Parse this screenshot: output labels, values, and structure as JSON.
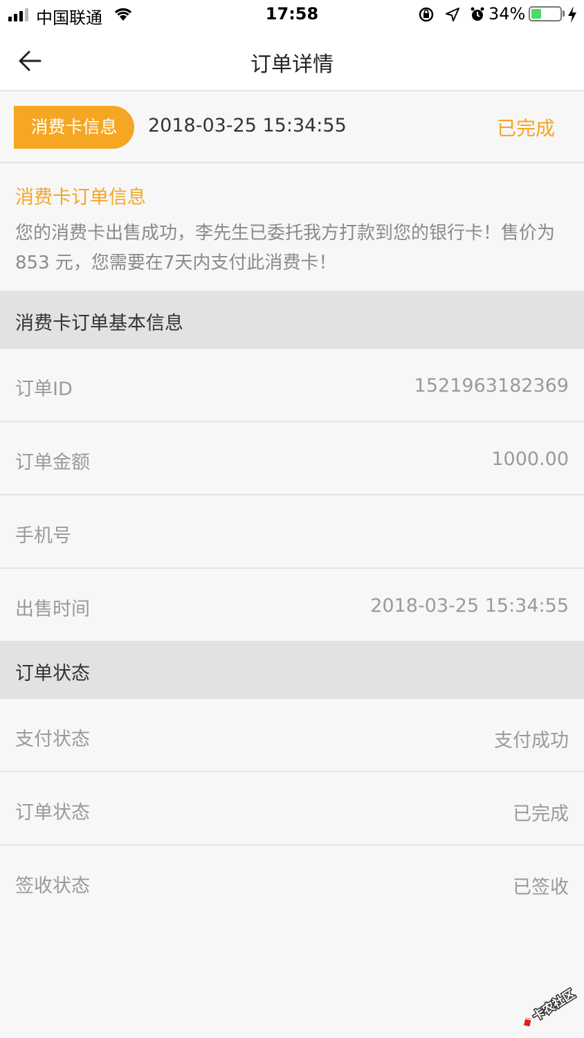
{
  "status_bar": {
    "carrier": "中国联通",
    "time": "17:58",
    "battery_percent": "34%",
    "battery_level": 0.34,
    "icons": [
      "signal-icon",
      "wifi-icon",
      "rotation-lock-icon",
      "location-icon",
      "alarm-icon",
      "battery-icon",
      "charging-icon"
    ]
  },
  "nav": {
    "title": "订单详情",
    "back_icon": "back-arrow-icon"
  },
  "header": {
    "badge": "消费卡信息",
    "datetime": "2018-03-25 15:34:55",
    "status": "已完成"
  },
  "info": {
    "title": "消费卡订单信息",
    "message": "您的消费卡出售成功，李先生已委托我方打款到您的银行卡！售价为 853 元，您需要在7天内支付此消费卡！"
  },
  "basic_section": {
    "title": "消费卡订单基本信息",
    "rows": [
      {
        "label": "订单ID",
        "value": "1521963182369"
      },
      {
        "label": "订单金额",
        "value": "1000.00"
      },
      {
        "label": "手机号",
        "value": ""
      },
      {
        "label": "出售时间",
        "value": "2018-03-25 15:34:55"
      }
    ]
  },
  "status_section": {
    "title": "订单状态",
    "rows": [
      {
        "label": "支付状态",
        "value": "支付成功"
      },
      {
        "label": "订单状态",
        "value": "已完成"
      },
      {
        "label": "签收状态",
        "value": "已签收"
      }
    ]
  },
  "watermark": {
    "text": "卡农社区"
  },
  "colors": {
    "accent": "#f5a623",
    "section_bg": "#e2e2e2",
    "page_bg": "#f7f7f7",
    "battery_green": "#4cd964"
  }
}
